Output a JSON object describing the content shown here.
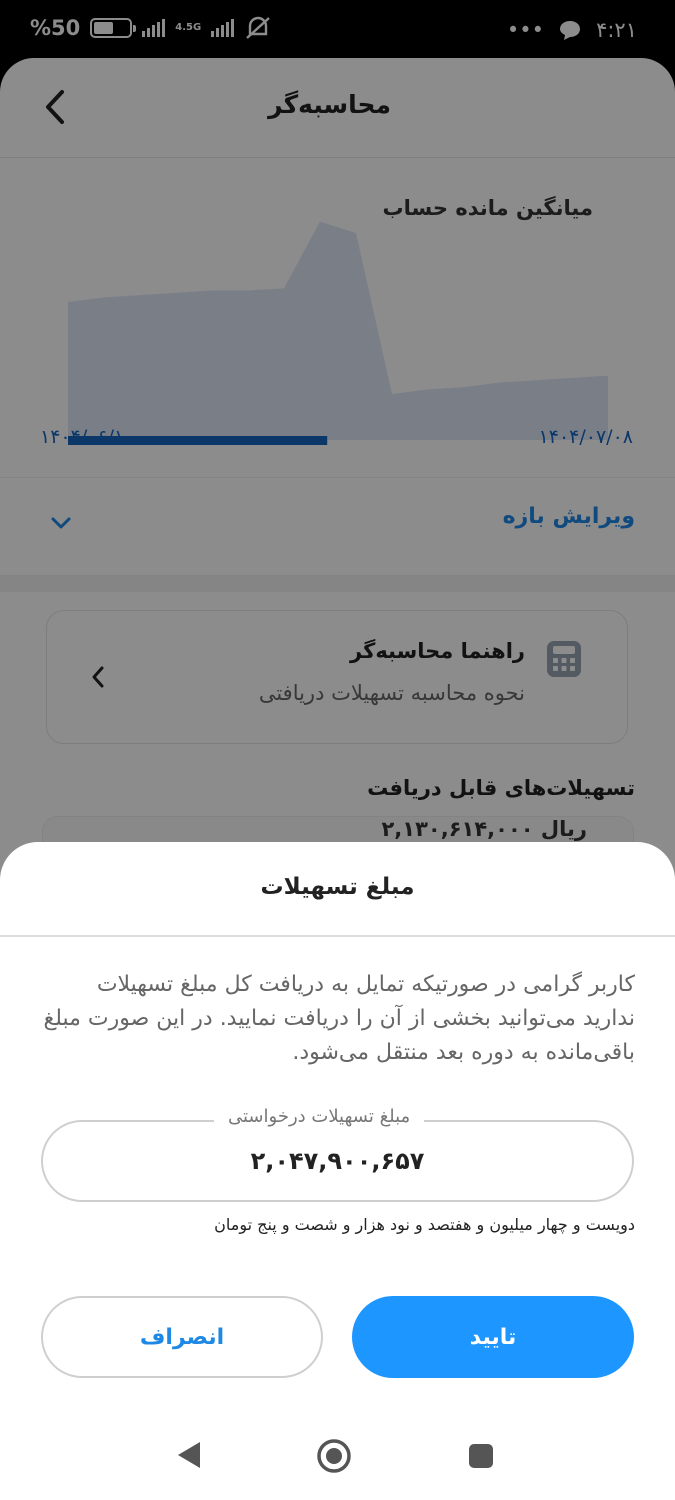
{
  "status_bar": {
    "battery": "%50",
    "network": "4.5G",
    "time": "۴:۲۱",
    "dots": "•••"
  },
  "header": {
    "title": "محاسبه‌گر"
  },
  "chart": {
    "title": "میانگین مانده حساب",
    "start_date": "۱۴۰۴/۰۶/۱۰",
    "end_date": "۱۴۰۴/۰۷/۰۸"
  },
  "chart_data": {
    "type": "area",
    "title": "میانگین مانده حساب",
    "x": [
      "۱۴۰۴/۰۶/۱۰",
      "۱۴۰۴/۰۷/۰۸"
    ],
    "series": [
      {
        "values": [
          0.6,
          0.62,
          0.63,
          0.64,
          0.65,
          0.65,
          0.66,
          0.95,
          0.9,
          0.2,
          0.22,
          0.23,
          0.25,
          0.26,
          0.27,
          0.28
        ]
      }
    ],
    "selected_fraction": 0.48
  },
  "range": {
    "label": "ویرایش بازه"
  },
  "guide": {
    "title": "راهنما محاسبه‌گر",
    "subtitle": "نحوه محاسبه تسهیلات دریافتی"
  },
  "loans": {
    "title": "تسهیلات‌های قابل دریافت",
    "amount": "۲,۱۳۰,۶۱۴,۰۰۰ ریال"
  },
  "sheet": {
    "title": "مبلغ تسهیلات",
    "body": "کاربر گرامی در صورتیکه تمایل به دریافت کل مبلغ تسهیلات ندارید می‌توانید بخشی از آن را دریافت نمایید. در این صورت مبلغ باقی‌مانده به دوره بعد منتقل می‌شود.",
    "field_label": "مبلغ تسهیلات درخواستی",
    "field_value": "۲,۰۴۷,۹۰۰,۶۵۷",
    "amount_words": "دویست و چهار میلیون و هفتصد و نود هزار و شصت و پنج تومان",
    "cancel_label": "انصراف",
    "confirm_label": "تایید"
  },
  "colors": {
    "accent": "#1e96ff",
    "link": "#1e88e5",
    "chart_bar": "#1565c0"
  }
}
